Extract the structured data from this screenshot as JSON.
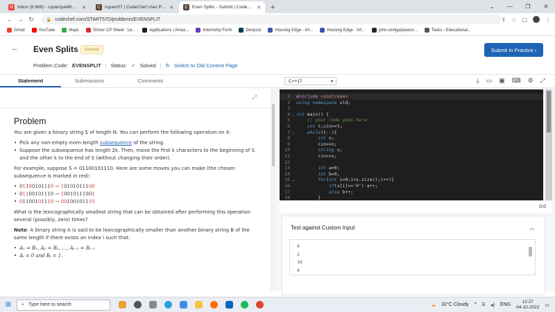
{
  "browser": {
    "tabs": [
      {
        "label": "Inbox (8,968) - rupampal48@gm",
        "favicon": "M",
        "color": "#ea4335",
        "active": false
      },
      {
        "label": "rupam07 | CodeChef User Profile",
        "favicon": "C",
        "color": "#5b4638",
        "active": false
      },
      {
        "label": "Even Splits - Submit | CodeChef",
        "favicon": "C",
        "color": "#5b4638",
        "active": true
      }
    ],
    "new_tab": "+",
    "url": "codechef.com/START57D/problems/EVENSPLIT",
    "bookmarks": [
      {
        "label": "Gmail",
        "color": "#ea4335"
      },
      {
        "label": "YouTube",
        "color": "#ff0000"
      },
      {
        "label": "Maps",
        "color": "#34a853"
      },
      {
        "label": "Striver CP Sheet : Le...",
        "color": "#d32f2f"
      },
      {
        "label": "Applications | Amaz...",
        "color": "#222222"
      },
      {
        "label": "Internship Form",
        "color": "#673ab7"
      },
      {
        "label": "Devpost",
        "color": "#003e54"
      },
      {
        "label": "Housing Edge - Inf...",
        "color": "#3f51b5"
      },
      {
        "label": "Housing Edge - Inf...",
        "color": "#3f51b5"
      },
      {
        "label": "john-smilga/javascr...",
        "color": "#24292e"
      },
      {
        "label": "Tasks - Educational...",
        "color": "#555555"
      }
    ]
  },
  "header": {
    "title": "Even Splits",
    "badge": "Scored",
    "submit_label": "Submit In Practice  ›",
    "problem_code_label": "Problem Code:",
    "problem_code": "EVENSPLIT",
    "status_label": "Status:",
    "status_value": "Solved",
    "old_contest_link": "Switch to Old Contest Page"
  },
  "panel_tabs": [
    "Statement",
    "Submissions",
    "Comments"
  ],
  "statement": {
    "heading": "Problem",
    "intro": "You are given a binary string S of length N. You can perform the following operation on it:",
    "bullet1_prefix": "Pick any non-empty even-length ",
    "bullet1_link": "subsequence",
    "bullet1_suffix": " of the string.",
    "bullet2": "Suppose the subsequence has length 2k. Then, move the first k characters to the beginning of S and the other k to the end of S (without changing their order).",
    "example": "For example, suppose S = 01100101110. Here are some moves you can make (the chosen subsequence is marked in red):",
    "moves": [
      {
        "before": [
          "0",
          "1",
          "1",
          "0",
          "0",
          "1",
          "0",
          "1",
          "1",
          "1",
          "0"
        ],
        "red": [
          1,
          3,
          10
        ],
        "after": "10101011100",
        "after_red": [
          0,
          9,
          10
        ]
      },
      {
        "before": [
          "0",
          "1",
          "1",
          "0",
          "0",
          "1",
          "0",
          "1",
          "1",
          "1",
          "0"
        ],
        "red": [
          1,
          2
        ],
        "after": "10010111001",
        "after_red": [
          0,
          10
        ]
      },
      {
        "before": [
          "0",
          "1",
          "1",
          "0",
          "0",
          "1",
          "0",
          "1",
          "1",
          "1",
          "0"
        ],
        "red": [
          0,
          6,
          9,
          10
        ],
        "after": "00100101110",
        "after_red": [
          0,
          1,
          9,
          10
        ]
      }
    ],
    "question": "What is the lexicographically smallest string that can be obtained after performing this operation several (possibly, zero) times?",
    "note_bold": "Note",
    "note": ": A binary string A is said to be lexicographically smaller than another binary string B of the same length if there exists an index i such that:",
    "conditions": [
      "A₁ = B₁, A₂ = B₂, …, Aᵢ₋₁ = Bᵢ₋₁",
      "Aᵢ = 0 and Bᵢ = 1."
    ]
  },
  "editor": {
    "language": "C++17",
    "cursor_pos": "0:0",
    "lines": [
      "#include <iostream>",
      "using namespace std;",
      "",
      "int main() {",
      "    // your code goes here",
      "    int t;cin>>t;",
      "    while(t--){",
      "        int n;",
      "        cin>>n;",
      "        string s;",
      "        cin>>s;",
      "",
      "        int a=0;",
      "        int b=0;",
      "        for(int i=0;i<s.size();i++){",
      "            if(s[i]=='0') a++;",
      "            else b++;",
      "        }"
    ]
  },
  "custom_input": {
    "title": "Test against Custom Input",
    "values": [
      "4",
      "2",
      "10",
      "4"
    ]
  },
  "taskbar": {
    "search_placeholder": "Type here to search",
    "weather": "32°C  Cloudy",
    "lang": "ENG",
    "time": "12:27",
    "date": "04-10-2022"
  }
}
